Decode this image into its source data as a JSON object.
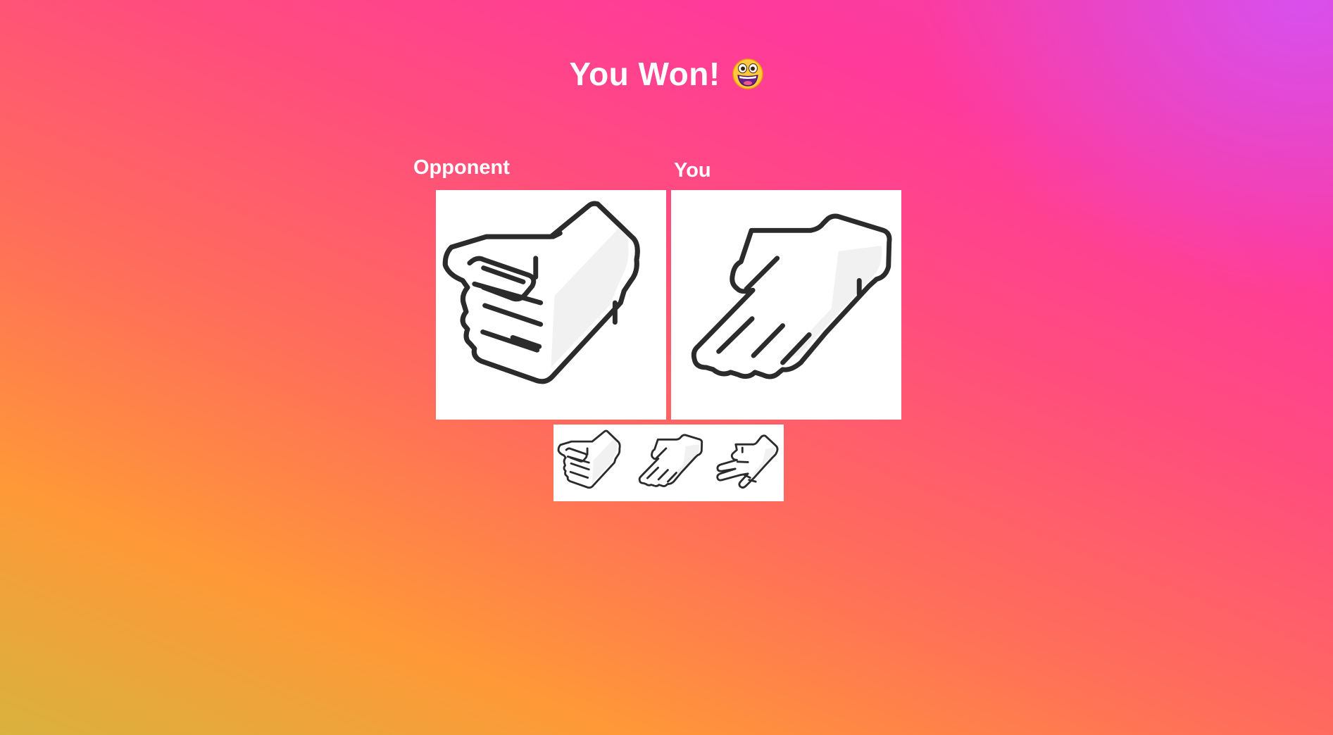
{
  "result": {
    "title": "You Won!",
    "emoji_icon": "grinning-face-icon"
  },
  "opponent": {
    "label": "Opponent",
    "choice": "rock",
    "hand_icon": "rock-fist-icon"
  },
  "player": {
    "label": "You",
    "choice": "paper",
    "hand_icon": "paper-hand-icon"
  },
  "choices": [
    {
      "value": "rock",
      "icon": "rock-fist-icon"
    },
    {
      "value": "paper",
      "icon": "paper-hand-icon"
    },
    {
      "value": "scissors",
      "icon": "scissors-hand-icon"
    }
  ],
  "colors": {
    "text": "#ffffff",
    "card_background": "#ffffff",
    "outline": "#2b2b2b",
    "shade": "#f1f1f1",
    "emoji_face": "#ffc83d",
    "emoji_mouth": "#6b1f8a"
  }
}
